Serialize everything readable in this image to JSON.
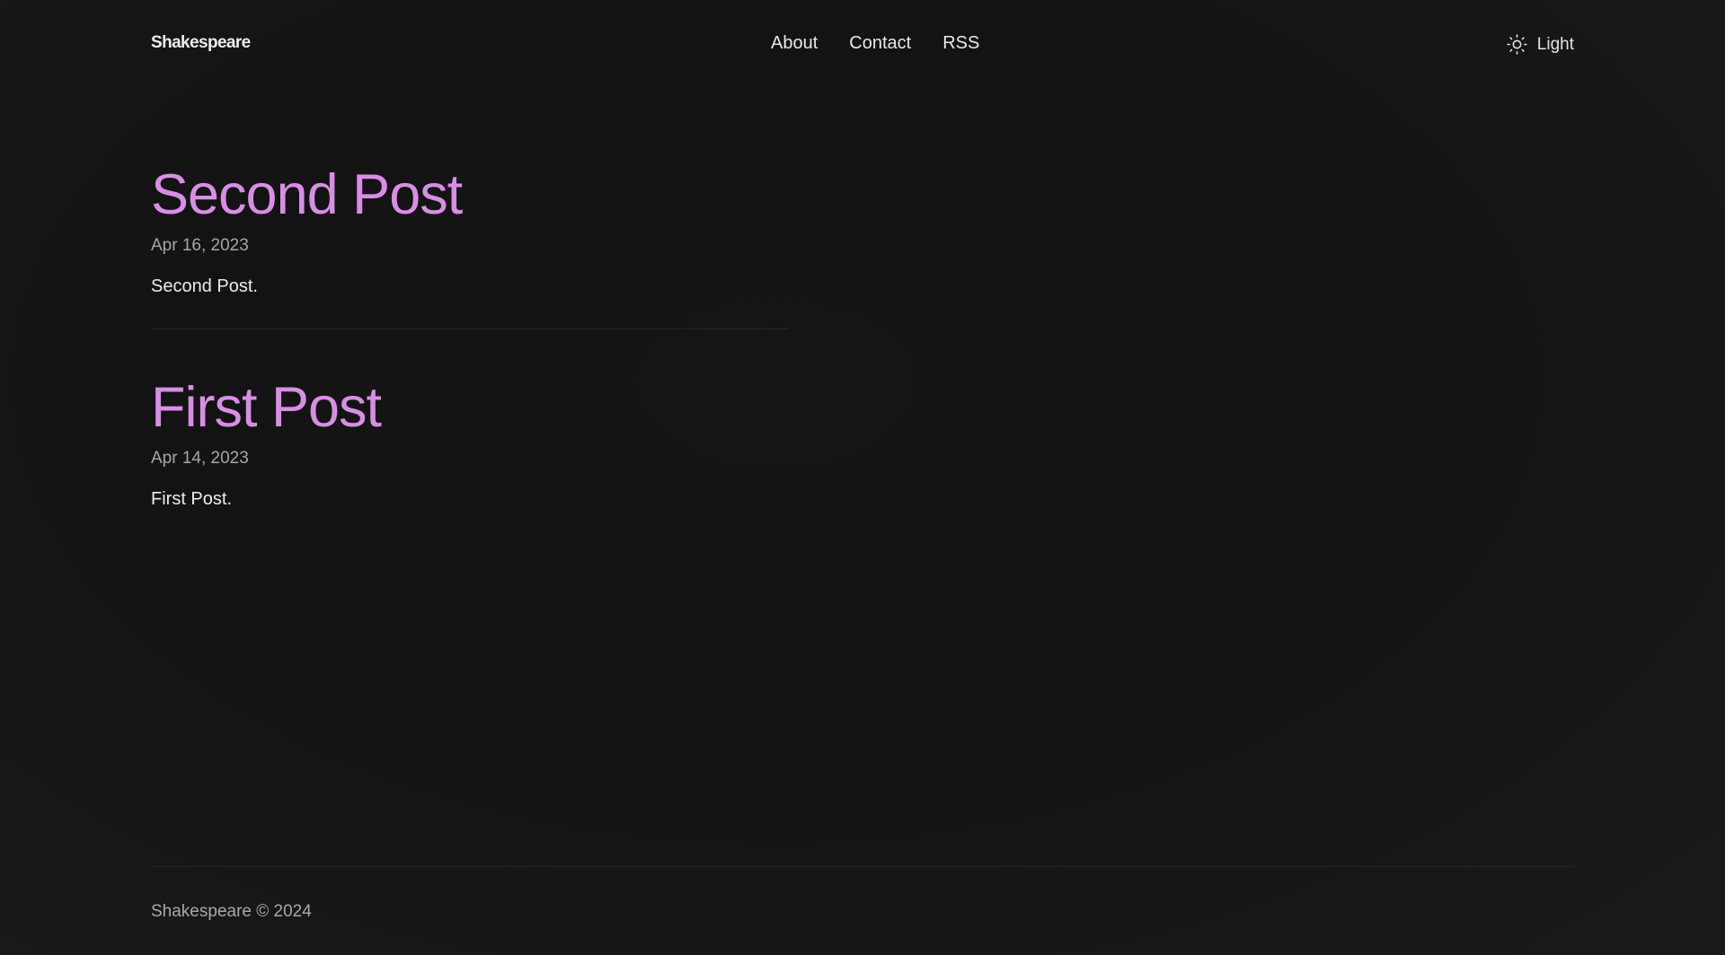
{
  "header": {
    "logo": "Shakespeare",
    "nav": [
      "About",
      "Contact",
      "RSS"
    ],
    "theme_toggle": {
      "label": "Light",
      "icon": "sun-icon"
    }
  },
  "posts": [
    {
      "title": "Second Post",
      "date": "Apr 16, 2023",
      "description": "Second Post."
    },
    {
      "title": "First Post",
      "date": "Apr 14, 2023",
      "description": "First Post."
    }
  ],
  "footer": {
    "text": "Shakespeare © 2024"
  },
  "colors": {
    "background": "#131313",
    "accent": "#d98ee6",
    "text": "#e8e8e8",
    "muted": "#a7a7a7",
    "divider": "#262626"
  }
}
